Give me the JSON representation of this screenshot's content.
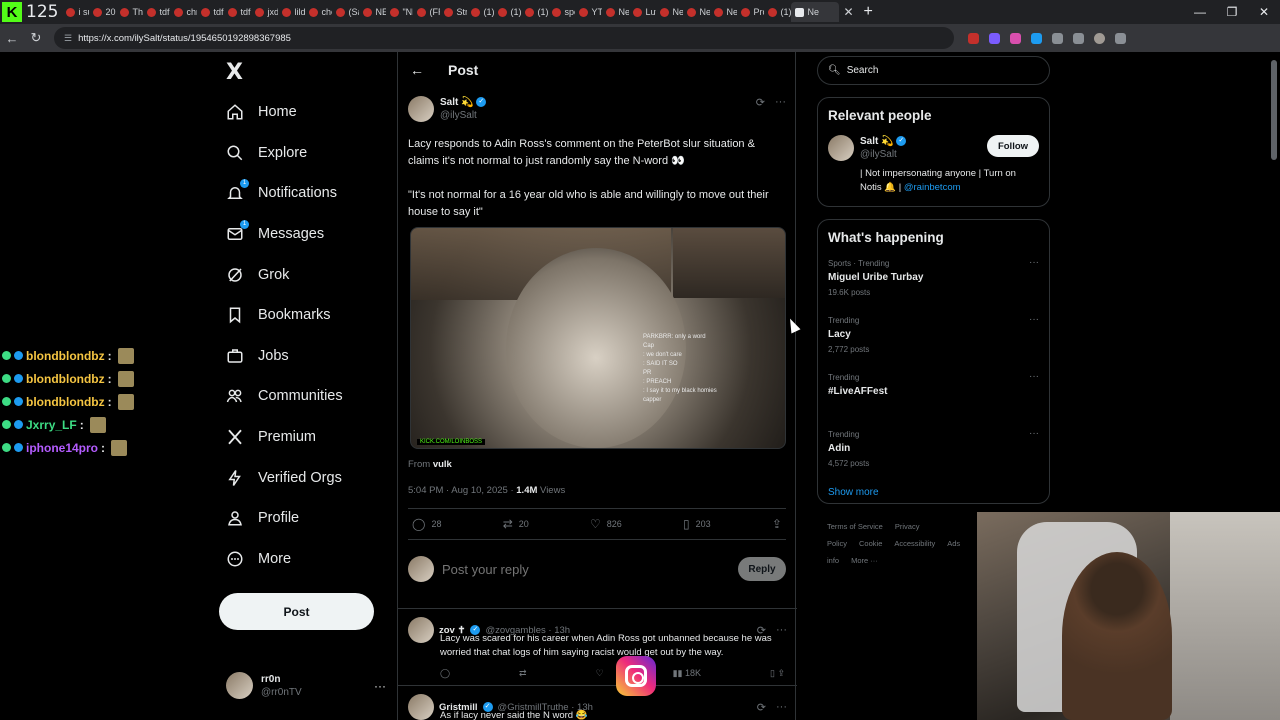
{
  "browser": {
    "tab_count": "125",
    "tabs": [
      "i su",
      "201",
      "The",
      "tdf",
      "chri",
      "tdf",
      "tdf",
      "jxdc",
      "lildr",
      "che",
      "(Sa",
      "NE",
      "\"NE",
      "(FR",
      "Stre",
      "(1)",
      "(1)",
      "(1)",
      "spe",
      "YTh",
      "Ne",
      "Luv",
      "Ne",
      "Ne",
      "Ne",
      "Pro",
      "(1)"
    ],
    "active_tab": "Ne",
    "url": "https://x.com/ilySalt/status/1954650192898367985"
  },
  "stream_chat": [
    {
      "user": "blondblondbz",
      "color": "#f5c542",
      "sep": ":"
    },
    {
      "user": "blondblondbz",
      "color": "#f5c542",
      "sep": ":"
    },
    {
      "user": "blondblondbz",
      "color": "#f5c542",
      "sep": ":"
    },
    {
      "user": "Jxrry_LF",
      "color": "#3ddc84",
      "sep": ":"
    },
    {
      "user": "iphone14pro",
      "color": "#b45cff",
      "sep": ":"
    }
  ],
  "sidebar": {
    "logo": "X",
    "items": [
      {
        "label": "Home",
        "icon": "home-icon"
      },
      {
        "label": "Explore",
        "icon": "search-icon"
      },
      {
        "label": "Notifications",
        "icon": "bell-icon"
      },
      {
        "label": "Messages",
        "icon": "mail-icon"
      },
      {
        "label": "Grok",
        "icon": "grok-icon"
      },
      {
        "label": "Bookmarks",
        "icon": "bookmark-icon"
      },
      {
        "label": "Jobs",
        "icon": "briefcase-icon"
      },
      {
        "label": "Communities",
        "icon": "people-icon"
      },
      {
        "label": "Premium",
        "icon": "x-icon"
      },
      {
        "label": "Verified Orgs",
        "icon": "lightning-icon"
      },
      {
        "label": "Profile",
        "icon": "person-icon"
      },
      {
        "label": "More",
        "icon": "more-circle-icon"
      }
    ],
    "post_button": "Post",
    "account": {
      "name": "rr0n",
      "handle": "@rr0nTV"
    }
  },
  "main": {
    "header_title": "Post",
    "post": {
      "author_name": "Salt 💫",
      "author_handle": "@ilySalt",
      "text_1": "Lacy responds to Adin Ross's comment on the PeterBot slur situation & claims it's not normal to just randomly say the N-word 👀",
      "text_2": "\"It's not normal for a 16 year old who is able and willingly to move out their house to say it\"",
      "media_watermark": "KICK.COM/LOINBOSS",
      "media_chat": [
        "PARKBRR: only a word",
        "Cap",
        ": we don't care",
        ": SAID IT SO",
        "PR",
        ": PREACH",
        ": I say it to my black homies",
        "capper"
      ],
      "from_label": "From",
      "from_source": "vulk",
      "time": "5:04 PM · Aug 10, 2025 ·",
      "views_count": "1.4M",
      "views_label": "Views",
      "replies": "28",
      "reposts": "20",
      "likes": "826",
      "bookmarks": "203"
    },
    "reply_placeholder": "Post your reply",
    "reply_button": "Reply",
    "replies": [
      {
        "name": "zov ✝",
        "handle": "@zovgambles · 13h",
        "text": "Lacy was scared for his career when Adin Ross got unbanned because he was worried that chat logs of him saying racist would get out by the way.",
        "views": "18K"
      },
      {
        "name": "Gristmill",
        "handle": "@GristmillTruthe · 13h",
        "text": "As if lacy never said the N word 😂",
        "views": ""
      }
    ]
  },
  "right": {
    "search_placeholder": "Search",
    "relevant_title": "Relevant people",
    "person": {
      "name": "Salt 💫",
      "handle": "@ilySalt",
      "follow": "Follow",
      "bio": "| Not impersonating anyone | Turn on Notis 🔔 |",
      "bio_link": "@rainbetcom"
    },
    "happening_title": "What's happening",
    "trends": [
      {
        "meta": "Sports · Trending",
        "title": "Miguel Uribe Turbay",
        "count": "19.6K posts"
      },
      {
        "meta": "Trending",
        "title": "Lacy",
        "count": "2,772 posts"
      },
      {
        "meta": "Trending",
        "title": "#LiveAFFest",
        "count": ""
      },
      {
        "meta": "Trending",
        "title": "Adin",
        "count": "4,572 posts"
      }
    ],
    "show_more": "Show more",
    "footer": [
      "Terms of Service",
      "Privacy Policy",
      "Cookie",
      "Accessibility",
      "Ads info",
      "More ···"
    ]
  },
  "colors": {
    "accent": "#1d9bf0",
    "background": "#000000",
    "kick": "#53fc18"
  }
}
